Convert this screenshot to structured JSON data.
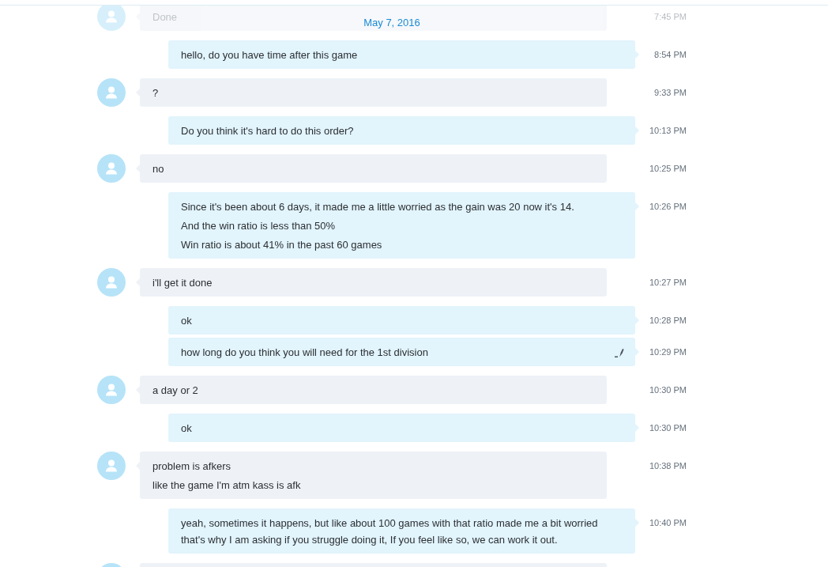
{
  "date_header": "May 7, 2016",
  "messages": [
    {
      "kind": "incoming",
      "faded": true,
      "edited": false,
      "paragraphs": [
        "Done"
      ],
      "time": "7:45 PM"
    },
    {
      "kind": "outgoing",
      "faded": false,
      "edited": false,
      "paragraphs": [
        "hello, do you have time after this game"
      ],
      "time": "8:54 PM"
    },
    {
      "kind": "incoming",
      "faded": false,
      "edited": false,
      "paragraphs": [
        "?"
      ],
      "time": "9:33 PM"
    },
    {
      "kind": "outgoing",
      "faded": false,
      "edited": false,
      "paragraphs": [
        "Do you think it's hard to do this order?"
      ],
      "time": "10:13 PM"
    },
    {
      "kind": "incoming",
      "faded": false,
      "edited": false,
      "paragraphs": [
        "no"
      ],
      "time": "10:25 PM"
    },
    {
      "kind": "outgoing",
      "faded": false,
      "edited": false,
      "paragraphs": [
        "Since it's been about 6 days, it made me a little worried as the gain was 20 now it's 14.",
        "And the win ratio is less than 50%",
        "Win ratio is about 41% in the past 60 games"
      ],
      "time": "10:26 PM"
    },
    {
      "kind": "incoming",
      "faded": false,
      "edited": false,
      "paragraphs": [
        "i'll get it done"
      ],
      "time": "10:27 PM"
    },
    {
      "kind": "outgoing",
      "faded": false,
      "edited": false,
      "paragraphs": [
        "ok"
      ],
      "time": "10:28 PM"
    },
    {
      "kind": "outgoing",
      "faded": false,
      "edited": true,
      "paragraphs": [
        "how long do you think you will need for the 1st division"
      ],
      "time": "10:29 PM"
    },
    {
      "kind": "incoming",
      "faded": false,
      "edited": false,
      "paragraphs": [
        "a day or 2"
      ],
      "time": "10:30 PM"
    },
    {
      "kind": "outgoing",
      "faded": false,
      "edited": false,
      "paragraphs": [
        "ok"
      ],
      "time": "10:30 PM"
    },
    {
      "kind": "incoming",
      "faded": false,
      "edited": false,
      "paragraphs": [
        "problem is afkers",
        "like the game I'm atm kass is afk"
      ],
      "time": "10:38 PM"
    },
    {
      "kind": "outgoing",
      "faded": false,
      "edited": false,
      "paragraphs": [
        "yeah, sometimes it happens, but like about 100 games with that ratio made me a bit worried that's why I am asking if you struggle doing it, If you feel like so, we can work it out."
      ],
      "time": "10:40 PM"
    },
    {
      "kind": "incoming",
      "faded": false
    }
  ]
}
